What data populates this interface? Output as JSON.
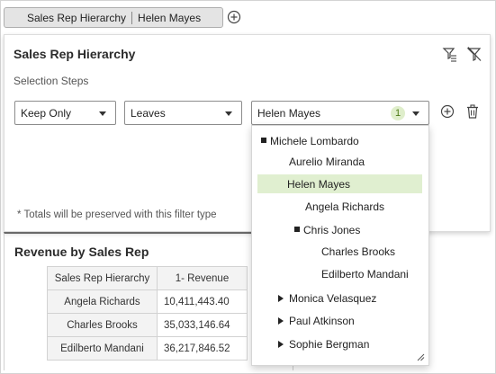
{
  "filter_chip": {
    "dimension": "Sales Rep Hierarchy",
    "value": "Helen Mayes"
  },
  "panel": {
    "title": "Sales Rep Hierarchy",
    "steps_label": "Selection Steps",
    "action_select": "Keep Only",
    "level_select": "Leaves",
    "members_select": "Helen Mayes",
    "members_count": "1",
    "totals_note": "* Totals will be preserved with this filter type"
  },
  "report": {
    "title": "Revenue by Sales Rep",
    "columns": [
      "Sales Rep Hierarchy",
      "1- Revenue"
    ],
    "rows": [
      {
        "name": "Angela Richards",
        "revenue": "10,411,443.40"
      },
      {
        "name": "Charles Brooks",
        "revenue": "35,033,146.64"
      },
      {
        "name": "Edilberto Mandani",
        "revenue": "36,217,846.52"
      }
    ]
  },
  "tree": {
    "items": [
      {
        "label": "Michele Lombardo",
        "expander": "expanded",
        "selected": false
      },
      {
        "label": "Aurelio Miranda",
        "expander": "none",
        "selected": false
      },
      {
        "label": "Helen Mayes",
        "expander": "none",
        "selected": true
      },
      {
        "label": "Angela Richards",
        "expander": "none",
        "selected": false
      },
      {
        "label": "Chris Jones",
        "expander": "expanded",
        "selected": false
      },
      {
        "label": "Charles Brooks",
        "expander": "none",
        "selected": false
      },
      {
        "label": "Edilberto Mandani",
        "expander": "none",
        "selected": false
      },
      {
        "label": "Monica Velasquez",
        "expander": "collapsed",
        "selected": false
      },
      {
        "label": "Paul Atkinson",
        "expander": "collapsed",
        "selected": false
      },
      {
        "label": "Sophie Bergman",
        "expander": "collapsed",
        "selected": false
      }
    ]
  },
  "icons": {
    "add_filter": "plus-circle-icon",
    "filter_settings": "filter-settings-icon",
    "clear_filter": "filter-clear-icon",
    "add_step": "plus-circle-icon",
    "delete_step": "trash-icon"
  },
  "colors": {
    "selected_bg": "#e0efd0",
    "badge_bg": "#dfeecb",
    "badge_text": "#4d7a16"
  }
}
